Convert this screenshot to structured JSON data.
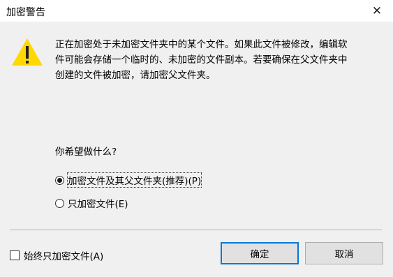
{
  "window": {
    "title": "加密警告",
    "close_glyph": "✕"
  },
  "message": {
    "lines": [
      "正在加密处于未加密文件夹中的某个文件。如果此文件被修改，编辑软",
      "件可能会存储一个临时的、未加密的文件副本。若要确保在父文件夹中",
      "创建的文件被加密，请加密父文件夹。"
    ]
  },
  "question": "你希望做什么?",
  "options": [
    {
      "label": "加密文件及其父文件夹(推荐)(P)",
      "selected": true
    },
    {
      "label": "只加密文件(E)",
      "selected": false
    }
  ],
  "always_checkbox": {
    "label": "始终只加密文件(A)",
    "checked": false
  },
  "buttons": {
    "ok": "确定",
    "cancel": "取消"
  },
  "icons": {
    "warning": "warning-triangle-icon"
  },
  "colors": {
    "warning_fill": "#ffd800",
    "accent": "#0078d7"
  }
}
